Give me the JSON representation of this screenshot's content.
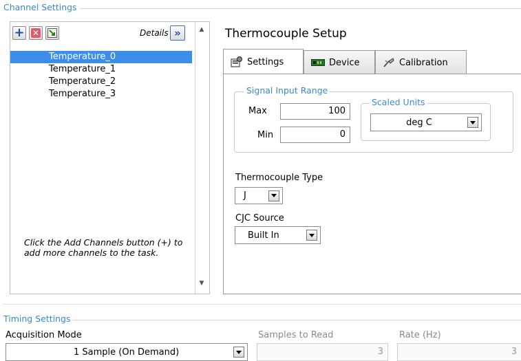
{
  "channel_settings": {
    "group_title": "Channel Settings",
    "details_label": "Details",
    "channels": [
      "Temperature_0",
      "Temperature_1",
      "Temperature_2",
      "Temperature_3"
    ],
    "hint": "Click the Add Channels button (+) to add more channels to the task."
  },
  "setup": {
    "title": "Thermocouple Setup",
    "tabs": [
      {
        "label": "Settings",
        "icon": "settings-icon"
      },
      {
        "label": "Device",
        "icon": "device-icon"
      },
      {
        "label": "Calibration",
        "icon": "calibration-icon"
      }
    ],
    "signal_input_range": {
      "title": "Signal Input Range",
      "max_label": "Max",
      "max_value": "100",
      "min_label": "Min",
      "min_value": "0"
    },
    "scaled_units": {
      "title": "Scaled Units",
      "value": "deg C"
    },
    "thermocouple_type": {
      "label": "Thermocouple Type",
      "value": "J"
    },
    "cjc_source": {
      "label": "CJC Source",
      "value": "Built In"
    }
  },
  "timing": {
    "group_title": "Timing Settings",
    "acquisition_mode_label": "Acquisition Mode",
    "acquisition_mode_value": "1 Sample (On Demand)",
    "samples_to_read_label": "Samples to Read",
    "samples_to_read_value": "3",
    "rate_label": "Rate (Hz)",
    "rate_value": "3"
  },
  "colors": {
    "accent": "#3a88d0",
    "selection": "#3d8ee8"
  }
}
